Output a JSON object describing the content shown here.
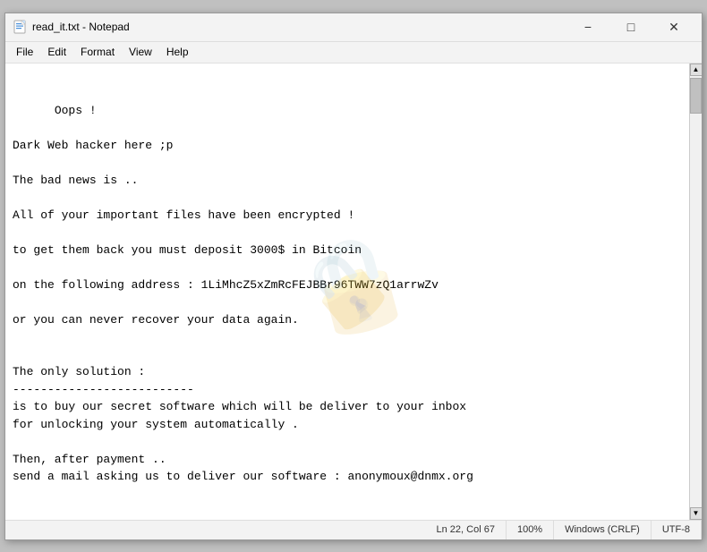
{
  "window": {
    "title": "read_it.txt - Notepad",
    "icon": "notepad-icon"
  },
  "title_controls": {
    "minimize": "−",
    "maximize": "□",
    "close": "✕"
  },
  "menu": {
    "items": [
      "File",
      "Edit",
      "Format",
      "View",
      "Help"
    ]
  },
  "content": {
    "text": "Oops !\n\nDark Web hacker here ;p\n\nThe bad news is ..\n\nAll of your important files have been encrypted !\n\nto get them back you must deposit 3000$ in Bitcoin\n\non the following address : 1LiMhcZ5xZmRcFEJBBr96TWW7zQ1arrwZv\n\nor you can never recover your data again.\n\n\nThe only solution :\n--------------------------\nis to buy our secret software which will be deliver to your inbox\nfor unlocking your system automatically .\n\nThen, after payment ..\nsend a mail asking us to deliver our software : anonymoux@dnmx.org"
  },
  "status_bar": {
    "line_col": "Ln 22, Col 67",
    "zoom": "100%",
    "line_ending": "Windows (CRLF)",
    "encoding": "UTF-8"
  },
  "watermark": {
    "text": "🔒"
  }
}
